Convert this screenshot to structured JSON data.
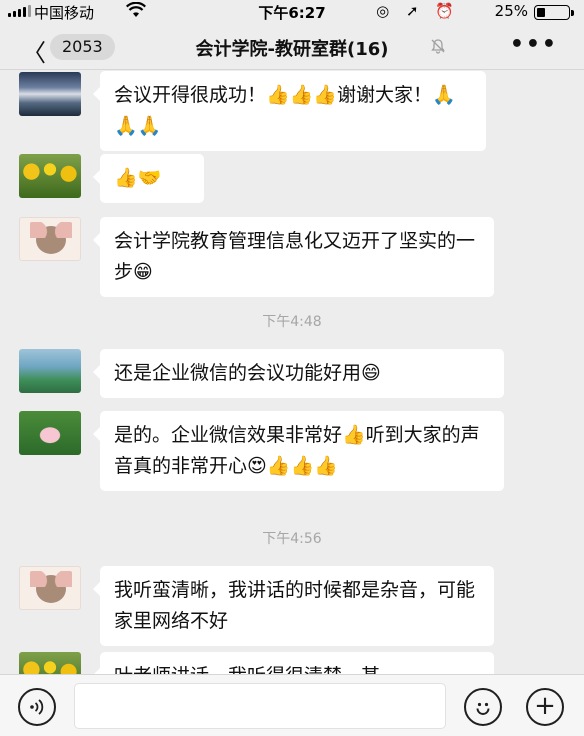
{
  "status_bar": {
    "carrier": "中国移动",
    "wifi_icon": "📶",
    "time": "下午6:27",
    "icons": "◎ ➚ ⏰",
    "battery": "25%"
  },
  "nav": {
    "back_icon": "〈",
    "unread_count": "2053",
    "title": "会计学院-教研室群(16)",
    "mute_icon": "🔕",
    "more_icon": "•••"
  },
  "messages": [
    {
      "avatar": "landscape",
      "text": "会议开得很成功！👍👍👍谢谢大家！🙏🙏🙏"
    },
    {
      "avatar": "tulips",
      "text": "👍🤝"
    },
    {
      "avatar": "mouse",
      "text": "会计学院教育管理信息化又迈开了坚实的一步😁"
    },
    {
      "timestamp": "下午4:48"
    },
    {
      "avatar": "game",
      "text": "还是企业微信的会议功能好用😄"
    },
    {
      "avatar": "lotus",
      "text": "是的。企业微信效果非常好👍听到大家的声音真的非常开心😍👍👍👍"
    },
    {
      "timestamp": "下午4:56"
    },
    {
      "avatar": "mouse",
      "text": "我听蛮清晰，我讲话的时候都是杂音，可能家里网络不好"
    },
    {
      "avatar": "tulips",
      "text": "叶老师讲话，我听得很清楚，甚"
    }
  ],
  "input_bar": {
    "voice_icon": "◉)",
    "emoji_icon": "☺",
    "plus_icon": "+"
  }
}
